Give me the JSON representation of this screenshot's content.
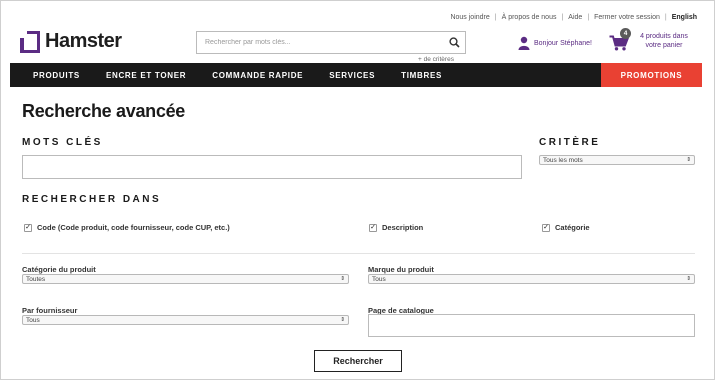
{
  "header": {
    "links": [
      "Nous joindre",
      "À propos de nous",
      "Aide",
      "Fermer votre session",
      "English"
    ],
    "logo_text": "Hamster",
    "search_placeholder": "Rechercher par mots clés...",
    "more_criteria": "+ de critères",
    "user_greeting": "Bonjour Stéphane!",
    "cart_count": "4",
    "cart_label": "4 produits dans votre panier"
  },
  "nav": {
    "items": [
      "PRODUITS",
      "ENCRE ET TONER",
      "COMMANDE RAPIDE",
      "SERVICES",
      "TIMBRES"
    ],
    "promo": "PROMOTIONS"
  },
  "form": {
    "title": "Recherche avancée",
    "keywords_heading": "MOTS CLÉS",
    "keywords_value": "",
    "criteria_heading": "CRITÈRE",
    "criteria_value": "Tous les mots",
    "search_in_heading": "RECHERCHER DANS",
    "checkboxes": [
      {
        "label": "Code (Code produit, code fournisseur, code CUP, etc.)",
        "checked": true
      },
      {
        "label": "Description",
        "checked": true
      },
      {
        "label": "Catégorie",
        "checked": true
      }
    ],
    "category_label": "Catégorie du produit",
    "category_value": "Toutes",
    "brand_label": "Marque du produit",
    "brand_value": "Tous",
    "supplier_label": "Par fournisseur",
    "supplier_value": "Tous",
    "catalog_page_label": "Page de catalogue",
    "catalog_page_value": "",
    "submit_label": "Rechercher"
  },
  "colors": {
    "brand_purple": "#5b2c83",
    "nav_bg": "#1a1a1a",
    "promo_red": "#e94133"
  }
}
